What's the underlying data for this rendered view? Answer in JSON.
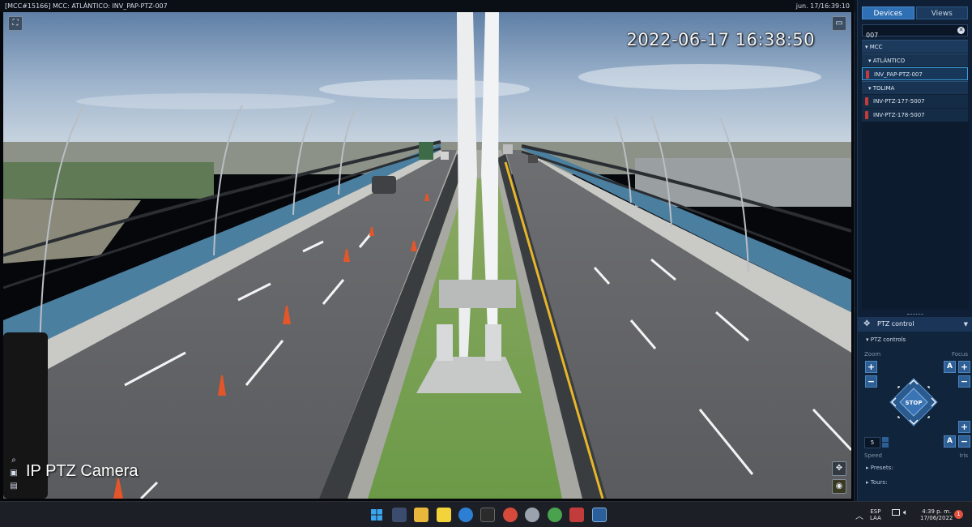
{
  "window": {
    "title_left": "[MCC#15166] MCC: ATLÁNTICO: INV_PAP-PTZ-007",
    "title_right": "jun. 17/16:39:10"
  },
  "video": {
    "osd_timestamp": "2022-06-17 16:38:50",
    "osd_camera_name": "IP PTZ Camera",
    "fullscreen_icon": "fullscreen-icon",
    "aspect_icon": "aspect-ratio-icon",
    "tools": [
      "zoom-icon",
      "snapshot-icon",
      "export-icon"
    ]
  },
  "sidebar": {
    "tabs": [
      {
        "label": "Devices",
        "active": true
      },
      {
        "label": "Views",
        "active": false
      }
    ],
    "search_value": "007",
    "tree": {
      "root": "MCC",
      "groups": [
        {
          "label": "ATLÁNTICO",
          "items": [
            "INV_PAP-PTZ-007"
          ]
        },
        {
          "label": "TOLIMA",
          "items": [
            "INV-PTZ-177-5007",
            "INV-PTZ-178-5007"
          ]
        }
      ]
    }
  },
  "ptz": {
    "panel_title": "PTZ control",
    "section_title": "PTZ controls",
    "zoom_label": "Zoom",
    "focus_label": "Focus",
    "plus": "+",
    "minus": "−",
    "auto": "A",
    "stop_label": "STOP",
    "speed_value": "5",
    "speed_label": "Speed",
    "iris_label": "Iris",
    "presets_label": "Presets:",
    "tours_label": "Tours:"
  },
  "taskbar": {
    "lang_top": "ESP",
    "lang_bottom": "LAA",
    "time": "4:39 p. m.",
    "date": "17/06/2022",
    "notifications": "1",
    "apps": [
      "windows-start-icon",
      "task-view-icon",
      "file-explorer-icon",
      "sticky-notes-icon",
      "edge-icon",
      "terminal-icon",
      "chrome-icon",
      "app-icon",
      "chrome-profile-icon",
      "media-icon",
      "vms-client-icon"
    ]
  }
}
